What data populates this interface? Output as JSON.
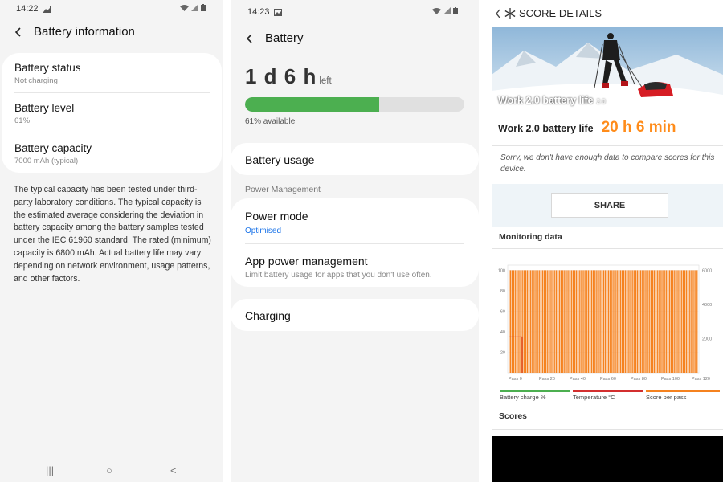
{
  "panel1": {
    "time": "14:22",
    "title": "Battery information",
    "rows": [
      {
        "title": "Battery status",
        "sub": "Not charging"
      },
      {
        "title": "Battery level",
        "sub": "61%"
      },
      {
        "title": "Battery capacity",
        "sub": "7000 mAh (typical)"
      }
    ],
    "description": "The typical capacity has been tested under third-party laboratory conditions. The typical capacity is the estimated average considering the deviation in battery capacity among the battery samples tested under the IEC 61960 standard. The rated (minimum) capacity is 6800 mAh. Actual battery life may vary depending on network environment, usage patterns, and other factors.",
    "nav": {
      "recents": "|||",
      "home": "○",
      "back": "<"
    }
  },
  "panel2": {
    "time": "14:23",
    "title": "Battery",
    "remaining": "1 d 6 h",
    "remaining_suffix": "left",
    "level_fraction": 0.61,
    "available": "61% available",
    "battery_usage": "Battery usage",
    "section": "Power Management",
    "power_mode": {
      "title": "Power mode",
      "value": "Optimised"
    },
    "app_power": {
      "title": "App power management",
      "sub": "Limit battery usage for apps that you don't use often."
    },
    "charging": "Charging"
  },
  "panel3": {
    "title": "SCORE DETAILS",
    "hero_caption": "Work 2.0 battery life",
    "hero_version": "2.0",
    "life_label": "Work 2.0 battery life",
    "life_value": "20 h 6 min",
    "sorry": "Sorry, we don't have enough data to compare scores for this device.",
    "share": "SHARE",
    "monitoring": "Monitoring data",
    "scores": "Scores",
    "colors": {
      "accent": "#ff8c1a",
      "battery": "#4caf50",
      "temperature": "#d32f2f",
      "score": "#f5821f"
    }
  },
  "chart_data": {
    "type": "bar",
    "y_left_ticks": [
      "100",
      "80",
      "60",
      "40",
      "20"
    ],
    "y_right_ticks": [
      "6000",
      "4000",
      "2000"
    ],
    "x_ticks": [
      "Pass 0",
      "Pass 20",
      "Pass 40",
      "Pass 60",
      "Pass 80",
      "Pass 100",
      "Pass 120"
    ],
    "series": [
      {
        "name": "Battery charge %",
        "color": "#4caf50"
      },
      {
        "name": "Temperature °C",
        "color": "#d32f2f",
        "values": [
          35,
          35,
          35,
          35,
          35
        ]
      },
      {
        "name": "Score per pass",
        "color": "#f5821f",
        "bar_count": 124,
        "approx_value": 6000
      }
    ],
    "ylim": [
      0,
      105
    ]
  }
}
